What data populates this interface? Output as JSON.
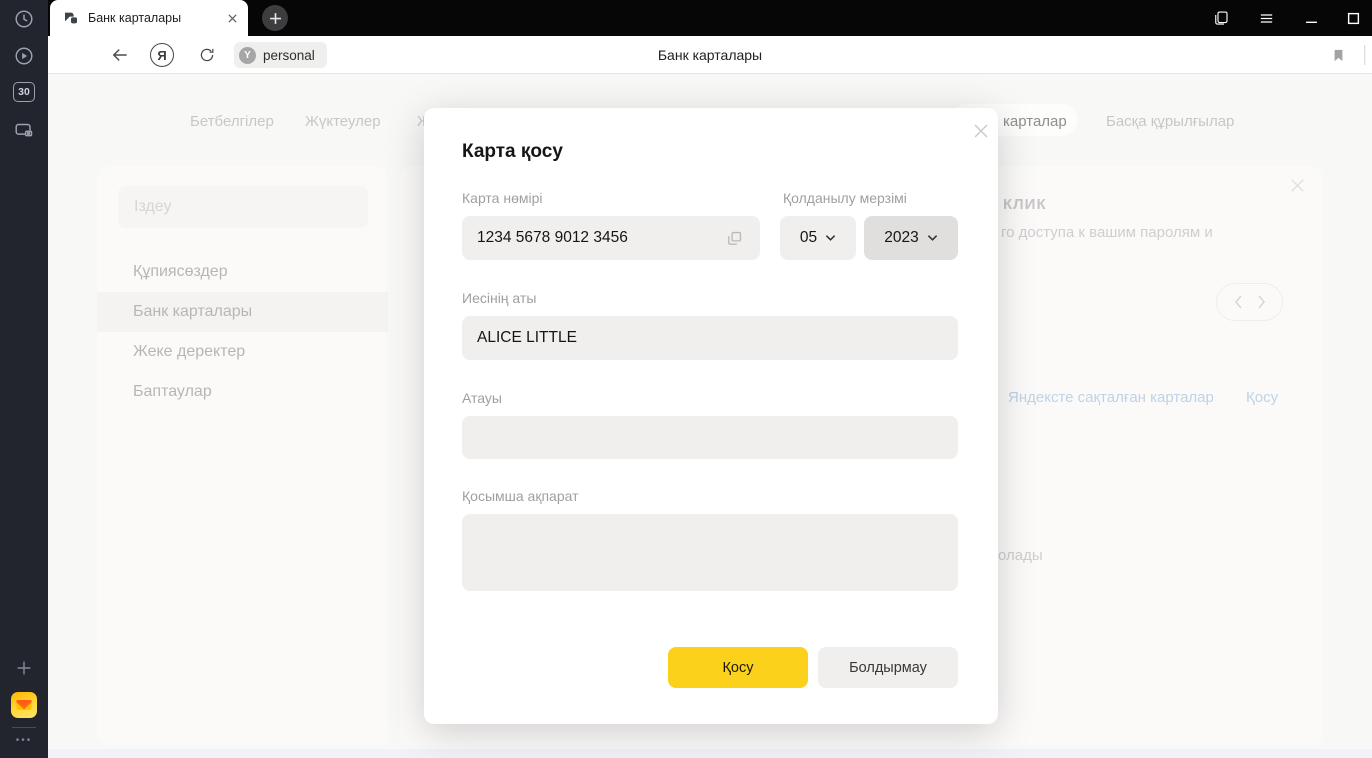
{
  "colors": {
    "accent_yellow": "#fbd11c",
    "sidebar_bg": "#23252e",
    "tabbar_bg": "#060607",
    "link_blue": "#7da6cb",
    "input_bg": "#f0efee"
  },
  "tabbar": {
    "tab_title": "Банк карталары"
  },
  "sidebar": {
    "timer_badge": "30",
    "ellipsis": "•••"
  },
  "toolbar": {
    "yandex_glyph": "Я",
    "protect_glyph": "Y",
    "site_badge": "personal",
    "page_title": "Банк карталары"
  },
  "page": {
    "tabs": {
      "bookmarks": "Бетбелгілер",
      "downloads": "Жүктеулер",
      "history_fragment": "Ж",
      "active_fragment": "карталар",
      "other_devices": "Басқа құрылғылар"
    },
    "nav": {
      "search_placeholder": "Іздеу",
      "items": [
        {
          "label": "Құпиясөздер"
        },
        {
          "label": "Банк карталары"
        },
        {
          "label": "Жеке деректер"
        },
        {
          "label": "Баптаулар"
        }
      ]
    },
    "promo": {
      "heading": "КЛИК",
      "text_fragment": "го доступа к вашим паролям и"
    },
    "saved_cards_link": "Яндексте сақталған карталар",
    "add_link": "Қосу",
    "bottom_text_fragment": "олады"
  },
  "modal": {
    "title": "Карта қосу",
    "card_number": {
      "label": "Карта нөмірі",
      "value": "1234 5678 9012 3456"
    },
    "expiry": {
      "label": "Қолданылу мерзімі",
      "month": "05",
      "year": "2023"
    },
    "holder": {
      "label": "Иесінің аты",
      "value": "ALICE LITTLE"
    },
    "card_name": {
      "label": "Атауы",
      "value": ""
    },
    "comment": {
      "label": "Қосымша ақпарат",
      "value": ""
    },
    "submit_label": "Қосу",
    "cancel_label": "Болдырмау"
  },
  "icons": {
    "sidebar": [
      "history-clock",
      "video-play",
      "timer-30",
      "screenshot-tool",
      "add-plus",
      "yandex-mail-app",
      "more-ellipsis"
    ],
    "toolbar": [
      "back-arrow",
      "yandex-logo",
      "refresh",
      "protect-shield",
      "bookmark-flag",
      "download-arrow"
    ],
    "window": [
      "tabs-panel",
      "menu-hamburger",
      "minimize",
      "maximize",
      "close"
    ]
  }
}
